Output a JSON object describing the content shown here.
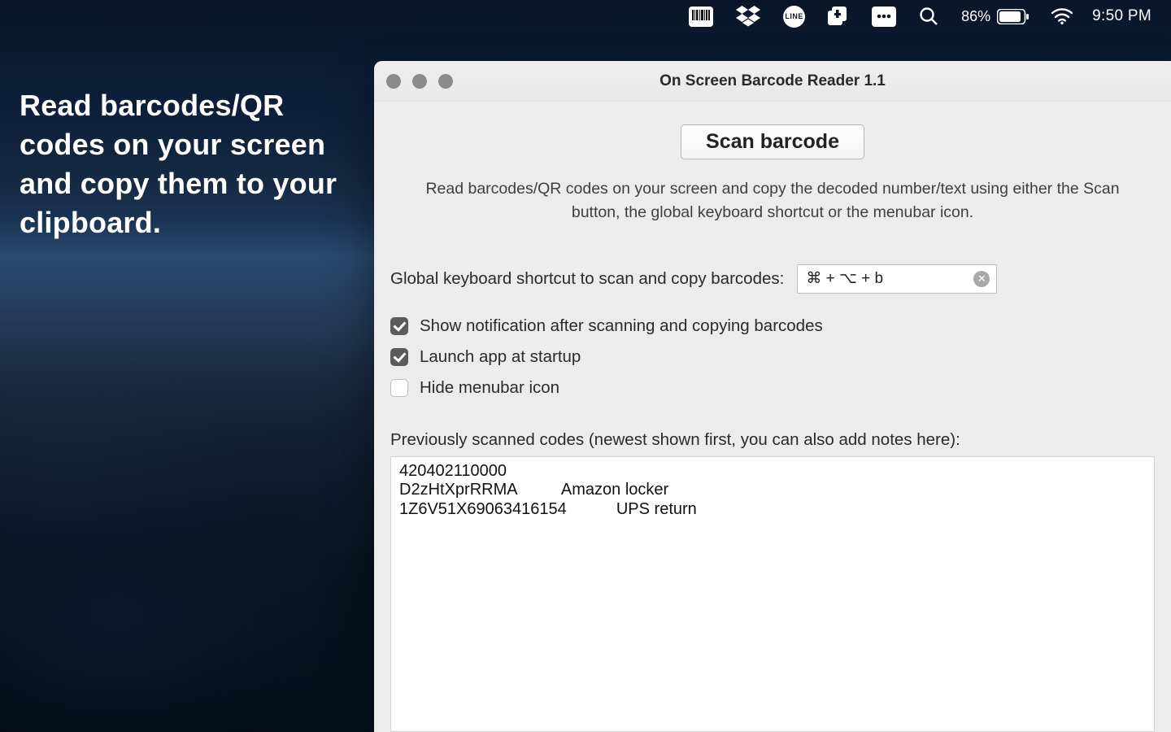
{
  "menubar": {
    "battery_percent": "86%",
    "time": "9:50 PM",
    "icons": [
      {
        "name": "barcode-icon"
      },
      {
        "name": "dropbox-icon"
      },
      {
        "name": "line-app-icon",
        "label": "LINE"
      },
      {
        "name": "library-icon"
      },
      {
        "name": "password-icon"
      },
      {
        "name": "search-icon"
      },
      {
        "name": "battery-icon"
      },
      {
        "name": "wifi-icon"
      }
    ]
  },
  "desktop": {
    "headline": "Read barcodes/QR codes on your screen and copy them to your clipboard."
  },
  "window": {
    "title": "On Screen Barcode Reader 1.1",
    "scan_button": "Scan barcode",
    "description": "Read barcodes/QR codes on your screen and copy the decoded number/text using either the Scan button, the global keyboard shortcut or the menubar icon.",
    "shortcut_label": "Global keyboard shortcut to scan and copy barcodes:",
    "shortcut_value": "⌘ + ⌥ + b",
    "options": [
      {
        "key": "show_notification",
        "label": "Show notification after scanning and copying barcodes",
        "checked": true
      },
      {
        "key": "launch_startup",
        "label": "Launch app at startup",
        "checked": true
      },
      {
        "key": "hide_menubar",
        "label": "Hide menubar icon",
        "checked": false
      }
    ],
    "history_label": "Previously scanned codes (newest shown first, you can also add notes here):",
    "history": [
      {
        "line": "420402110000"
      },
      {
        "line": "D2zHtXprRRMA          Amazon locker"
      },
      {
        "line": "1Z6V51X69063416154           UPS return"
      }
    ]
  }
}
